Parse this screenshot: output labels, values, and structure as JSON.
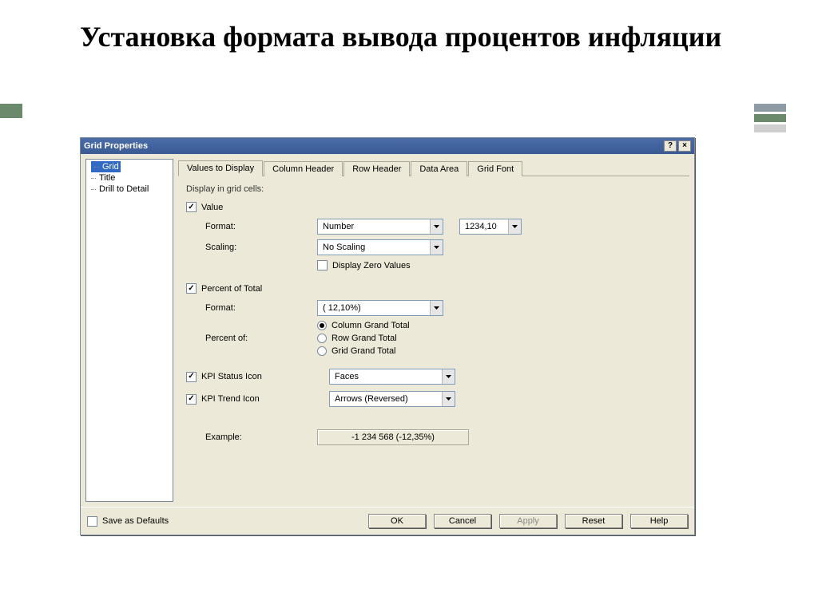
{
  "slide": {
    "title": "Установка формата вывода процентов инфляции"
  },
  "dialog": {
    "title": "Grid Properties",
    "help_btn": "?",
    "close_btn": "×"
  },
  "tree": {
    "items": [
      "Grid",
      "Title",
      "Drill to Detail"
    ],
    "selected": "Grid"
  },
  "tabs": {
    "items": [
      "Values to Display",
      "Column Header",
      "Row Header",
      "Data Area",
      "Grid Font"
    ],
    "active": "Values to Display"
  },
  "content": {
    "display_in_cells": "Display in grid cells:",
    "value_chk": "Value",
    "format_lbl": "Format:",
    "format_val": "Number",
    "format_sample": "1234,10",
    "scaling_lbl": "Scaling:",
    "scaling_val": "No Scaling",
    "display_zero": "Display Zero Values",
    "percent_total_chk": "Percent of Total",
    "percent_format_val": "( 12,10%)",
    "percent_of_lbl": "Percent of:",
    "radio_col": "Column Grand Total",
    "radio_row": "Row Grand Total",
    "radio_grid": "Grid Grand Total",
    "kpi_status_chk": "KPI Status Icon",
    "kpi_status_val": "Faces",
    "kpi_trend_chk": "KPI Trend Icon",
    "kpi_trend_val": "Arrows (Reversed)",
    "example_lbl": "Example:",
    "example_val": "-1 234 568   (-12,35%)"
  },
  "buttons": {
    "save_defaults": "Save as Defaults",
    "ok": "OK",
    "cancel": "Cancel",
    "apply": "Apply",
    "reset": "Reset",
    "help": "Help"
  }
}
